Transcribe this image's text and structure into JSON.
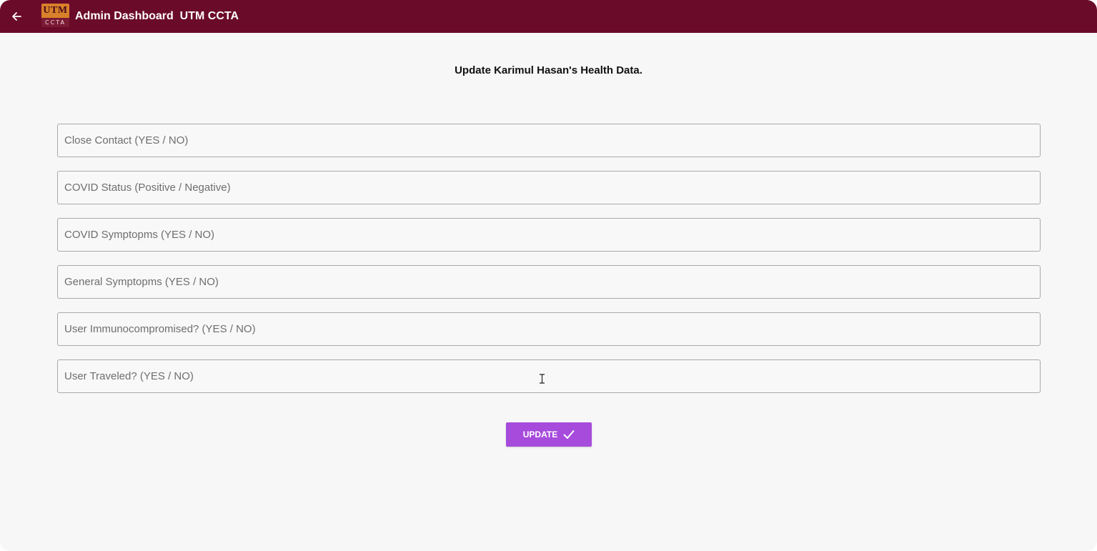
{
  "appbar": {
    "title": "Admin Dashboard  UTM CCTA",
    "logo_top": "UTM",
    "logo_bottom": "CCTA",
    "back_icon": "arrow-left-icon",
    "background_color": "#6b0b2a"
  },
  "page": {
    "title": "Update Karimul Hasan's Health Data."
  },
  "fields": [
    {
      "placeholder": "Close Contact (YES / NO)",
      "value": ""
    },
    {
      "placeholder": "COVID Status (Positive / Negative)",
      "value": ""
    },
    {
      "placeholder": "COVID Symptopms (YES / NO)",
      "value": ""
    },
    {
      "placeholder": "General Symptopms (YES / NO)",
      "value": ""
    },
    {
      "placeholder": "User Immunocompromised? (YES / NO)",
      "value": ""
    },
    {
      "placeholder": "User Traveled? (YES / NO)",
      "value": ""
    }
  ],
  "update_button": {
    "label": "UPDATE",
    "icon": "check-icon",
    "color": "#a64bdc"
  }
}
